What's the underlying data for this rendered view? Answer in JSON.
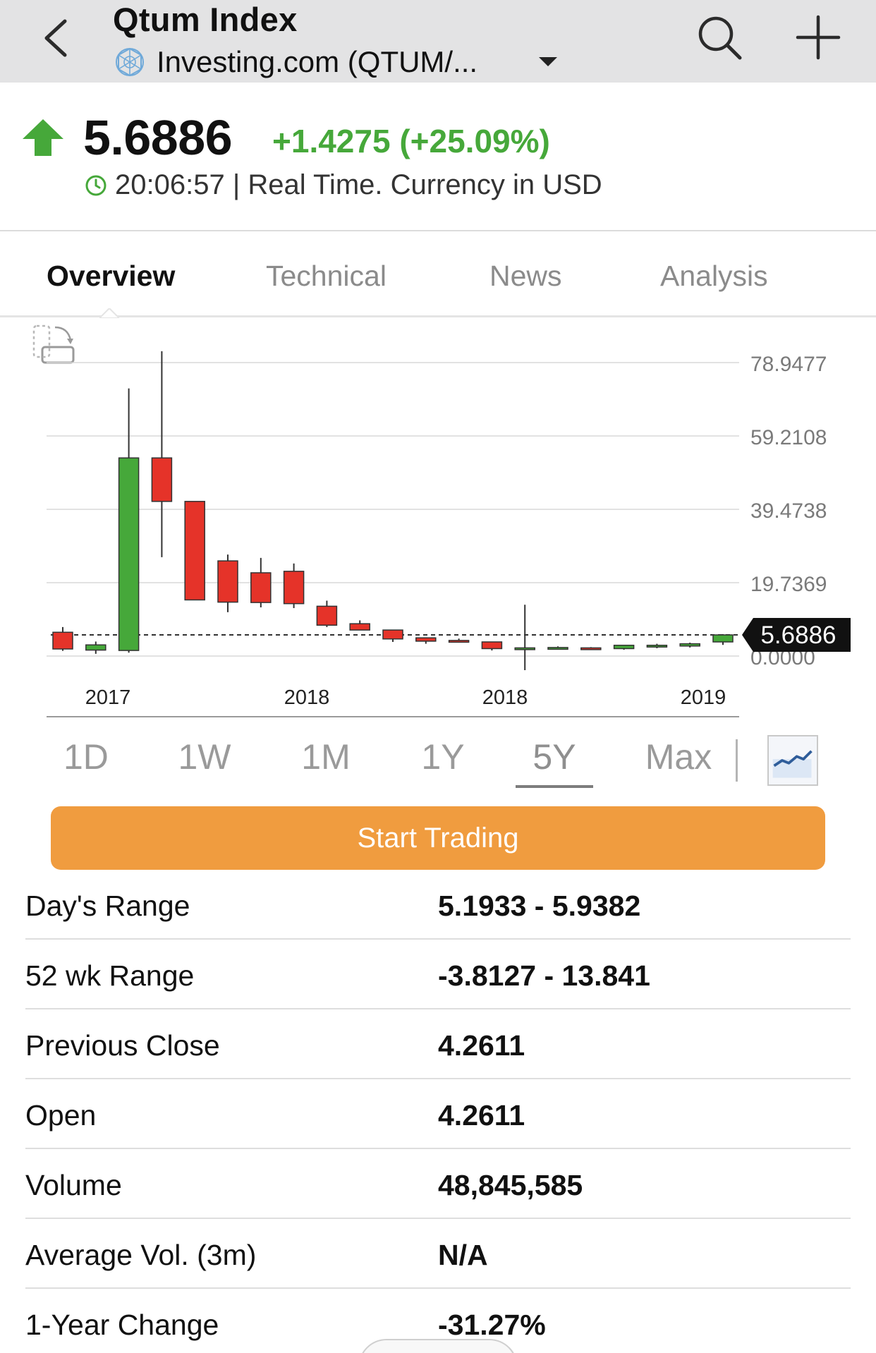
{
  "header": {
    "title": "Qtum Index",
    "subtitle": "Investing.com (QTUM/...",
    "icons": {
      "back": "chevron-left-icon",
      "globe": "globe-icon",
      "dropdown": "caret-down-icon",
      "search": "search-icon",
      "add": "plus-icon"
    }
  },
  "quote": {
    "price": "5.6886",
    "change": "+1.4275 (+25.09%)",
    "time": "20:06:57 | Real Time. Currency in USD",
    "direction_icon": "arrow-up-icon",
    "up_color": "#46a83a",
    "down_color": "#e53329"
  },
  "tabs": [
    {
      "label": "Overview",
      "active": true
    },
    {
      "label": "Technical",
      "active": false
    },
    {
      "label": "News",
      "active": false
    },
    {
      "label": "Analysis",
      "active": false
    }
  ],
  "chart_data": {
    "type": "candlestick",
    "y_ticks": [
      "78.9477",
      "59.2108",
      "39.4738",
      "19.7369",
      "0.0000"
    ],
    "x_ticks": [
      "2017",
      "2018",
      "2018",
      "2019"
    ],
    "ylim": [
      0,
      78.9477
    ],
    "last_price_label": "5.6886",
    "last_price": 5.6886,
    "grid": true,
    "candles": [
      {
        "o": 6.4,
        "h": 7.8,
        "l": 1.4,
        "c": 1.9
      },
      {
        "o": 1.6,
        "h": 3.9,
        "l": 0.6,
        "c": 3.0
      },
      {
        "o": 1.5,
        "h": 72.0,
        "l": 0.9,
        "c": 53.3
      },
      {
        "o": 53.3,
        "h": 82.0,
        "l": 26.6,
        "c": 41.6
      },
      {
        "o": 41.6,
        "h": 41.6,
        "l": 16.1,
        "c": 15.1
      },
      {
        "o": 25.6,
        "h": 27.3,
        "l": 11.8,
        "c": 14.5
      },
      {
        "o": 22.4,
        "h": 26.4,
        "l": 13.1,
        "c": 14.4
      },
      {
        "o": 22.8,
        "h": 24.9,
        "l": 12.9,
        "c": 14.1
      },
      {
        "o": 13.4,
        "h": 14.9,
        "l": 7.8,
        "c": 8.3
      },
      {
        "o": 8.7,
        "h": 9.6,
        "l": 7.0,
        "c": 7.0
      },
      {
        "o": 7.0,
        "h": 7.0,
        "l": 3.8,
        "c": 4.6
      },
      {
        "o": 4.9,
        "h": 4.9,
        "l": 3.3,
        "c": 4.0
      },
      {
        "o": 4.2,
        "h": 4.7,
        "l": 3.6,
        "c": 3.8
      },
      {
        "o": 3.8,
        "h": 3.8,
        "l": 1.5,
        "c": 2.0
      },
      {
        "o": 2.1,
        "h": 13.8,
        "l": -3.8,
        "c": 2.2
      },
      {
        "o": 2.2,
        "h": 2.6,
        "l": 1.8,
        "c": 2.3
      },
      {
        "o": 2.2,
        "h": 2.4,
        "l": 1.9,
        "c": 2.1
      },
      {
        "o": 2.0,
        "h": 2.9,
        "l": 1.7,
        "c": 2.9
      },
      {
        "o": 2.6,
        "h": 3.3,
        "l": 2.1,
        "c": 2.9
      },
      {
        "o": 2.7,
        "h": 3.6,
        "l": 2.3,
        "c": 3.3
      },
      {
        "o": 3.8,
        "h": 5.9,
        "l": 3.0,
        "c": 5.6886
      }
    ]
  },
  "ranges": [
    {
      "label": "1D",
      "active": false
    },
    {
      "label": "1W",
      "active": false
    },
    {
      "label": "1M",
      "active": false
    },
    {
      "label": "1Y",
      "active": false
    },
    {
      "label": "5Y",
      "active": true
    },
    {
      "label": "Max",
      "active": false
    }
  ],
  "chart_type_icon": "line-chart-icon",
  "rotate_icon": "rotate-screen-icon",
  "cta": {
    "label": "Start Trading",
    "color": "#f09c3f"
  },
  "stats": [
    {
      "label": "Day's Range",
      "value": "5.1933 - 5.9382"
    },
    {
      "label": "52 wk Range",
      "value": "-3.8127 - 13.841"
    },
    {
      "label": "Previous Close",
      "value": "4.2611"
    },
    {
      "label": "Open",
      "value": "4.2611"
    },
    {
      "label": "Volume",
      "value": "48,845,585"
    },
    {
      "label": "Average Vol. (3m)",
      "value": "N/A"
    },
    {
      "label": "1-Year Change",
      "value": "-31.27%"
    }
  ]
}
